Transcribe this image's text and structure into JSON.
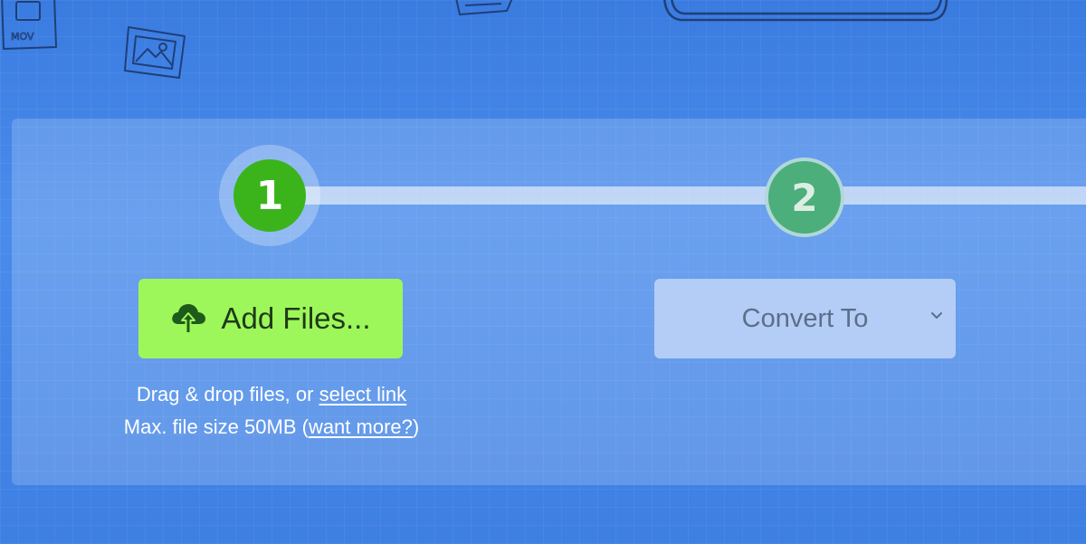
{
  "colors": {
    "background": "#3d7fe0",
    "step_active": "#3ab41a",
    "step_inactive": "#4cae7a",
    "primary_button": "#9ef75a",
    "select_background": "#b3cdf6"
  },
  "decor": {
    "mov_file_icon_label": "MOV",
    "icons": [
      "mov-file-icon",
      "image-file-icon",
      "card-icon",
      "laptop-sketch-icon"
    ]
  },
  "steps": [
    {
      "number": "1",
      "state": "active"
    },
    {
      "number": "2",
      "state": "inactive"
    }
  ],
  "upload": {
    "button_label": "Add Files...",
    "button_icon": "cloud-upload-icon",
    "drag_text": "Drag & drop files, or ",
    "select_link": "select link",
    "size_text": "Max. file size 50MB (",
    "want_more_link": "want more?",
    "size_text_end": ")"
  },
  "convert": {
    "select_value": "Convert To",
    "icon": "chevron-down-icon"
  }
}
